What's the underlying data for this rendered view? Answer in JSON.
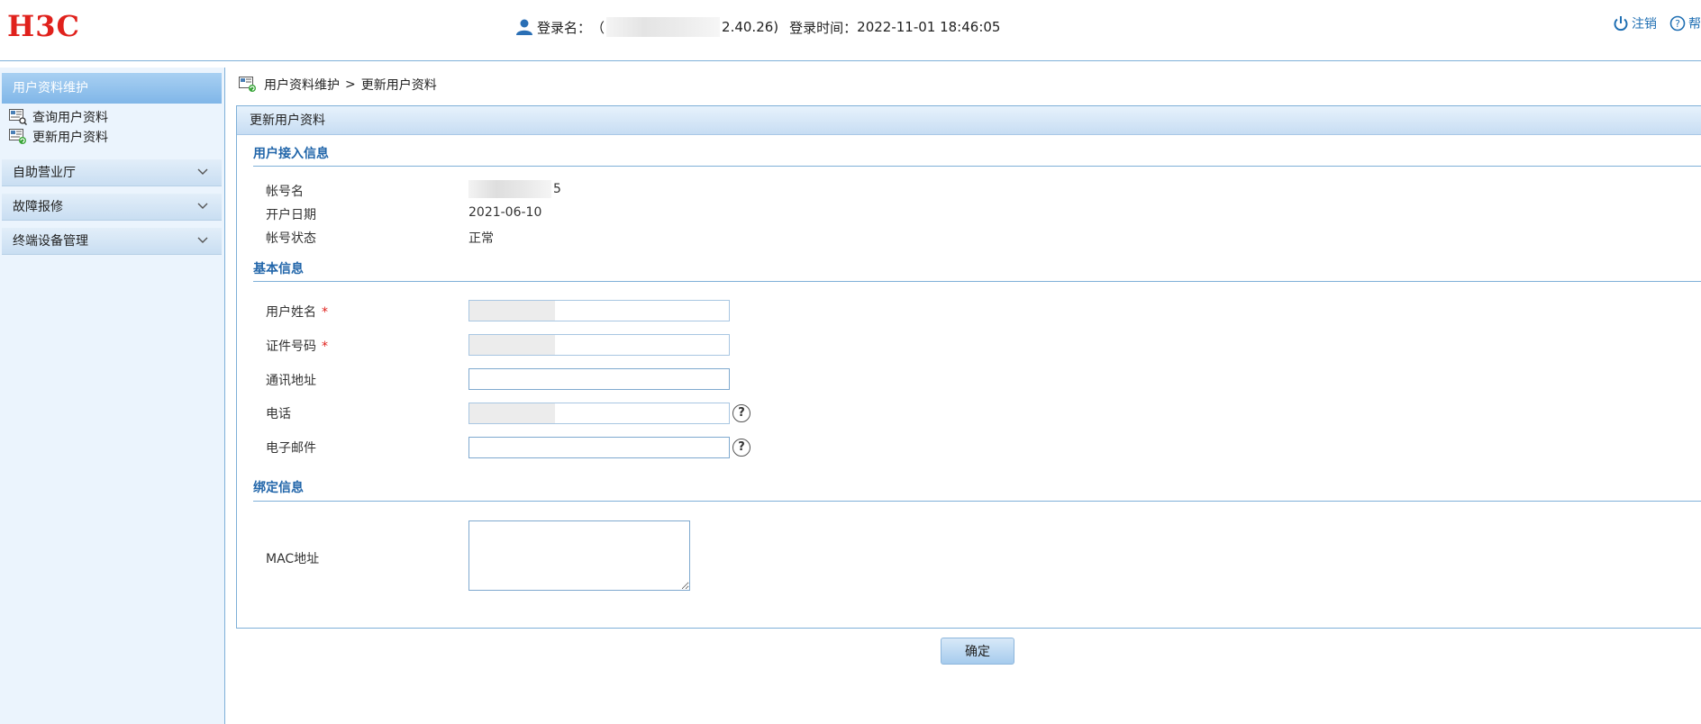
{
  "header": {
    "logo": "H3C",
    "login_label": "登录名：",
    "login_prefix": "（",
    "login_suffix": "2.40.26)",
    "login_time_label": "登录时间：",
    "login_time": "2022-11-01 18:46:05",
    "logout": "注销",
    "help": "帮"
  },
  "sidebar": {
    "title": "用户资料维护",
    "subitems": [
      {
        "label": "查询用户资料"
      },
      {
        "label": "更新用户资料"
      }
    ],
    "groups": [
      {
        "label": "自助营业厅"
      },
      {
        "label": "故障报修"
      },
      {
        "label": "终端设备管理"
      }
    ]
  },
  "breadcrumb": {
    "parent": "用户资料维护",
    "separator": ">",
    "current": "更新用户资料"
  },
  "panel": {
    "title": "更新用户资料",
    "access_section": "用户接入信息",
    "account_label": "帐号名",
    "account_value_suffix": "5",
    "open_date_label": "开户日期",
    "open_date": "2021-06-10",
    "status_label": "帐号状态",
    "status_value": "正常",
    "basic_section": "基本信息",
    "name_label": "用户姓名",
    "id_label": "证件号码",
    "required_mark": "*",
    "address_label": "通讯地址",
    "phone_label": "电话",
    "email_label": "电子邮件",
    "help_mark": "?",
    "bind_section": "绑定信息",
    "mac_label": "MAC地址",
    "confirm": "确定"
  }
}
